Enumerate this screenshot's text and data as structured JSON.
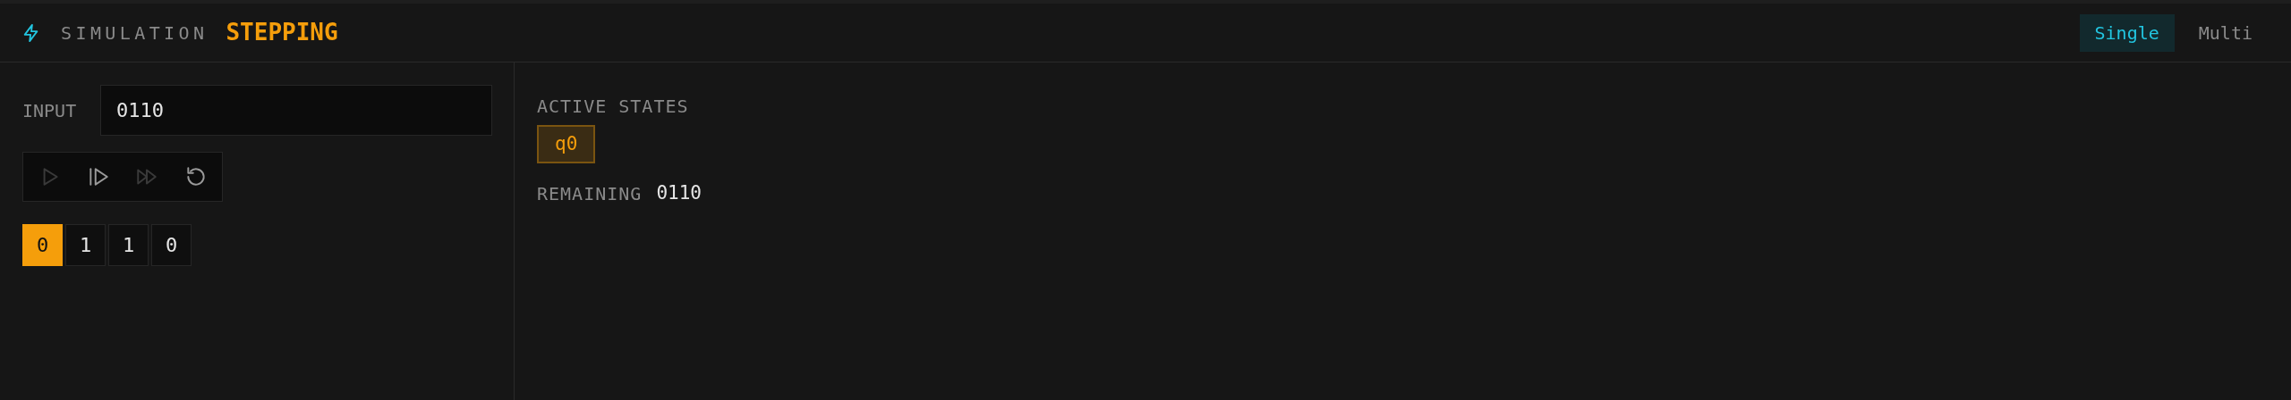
{
  "header": {
    "label": "SIMULATION",
    "status": "STEPPING"
  },
  "modes": [
    {
      "label": "Single",
      "selected": true
    },
    {
      "label": "Multi",
      "selected": false
    }
  ],
  "input": {
    "label": "INPUT",
    "value": "0110"
  },
  "controls": [
    {
      "kind": "play",
      "disabled": true
    },
    {
      "kind": "step",
      "disabled": false
    },
    {
      "kind": "fast-forward",
      "disabled": true
    },
    {
      "kind": "reset",
      "disabled": false
    }
  ],
  "tape": [
    {
      "symbol": "0",
      "selected": true
    },
    {
      "symbol": "1",
      "selected": false
    },
    {
      "symbol": "1",
      "selected": false
    },
    {
      "symbol": "0",
      "selected": false
    }
  ],
  "active_states": {
    "label": "ACTIVE STATES",
    "states": [
      "q0"
    ]
  },
  "remaining": {
    "label": "REMAINING",
    "value": "0110"
  }
}
